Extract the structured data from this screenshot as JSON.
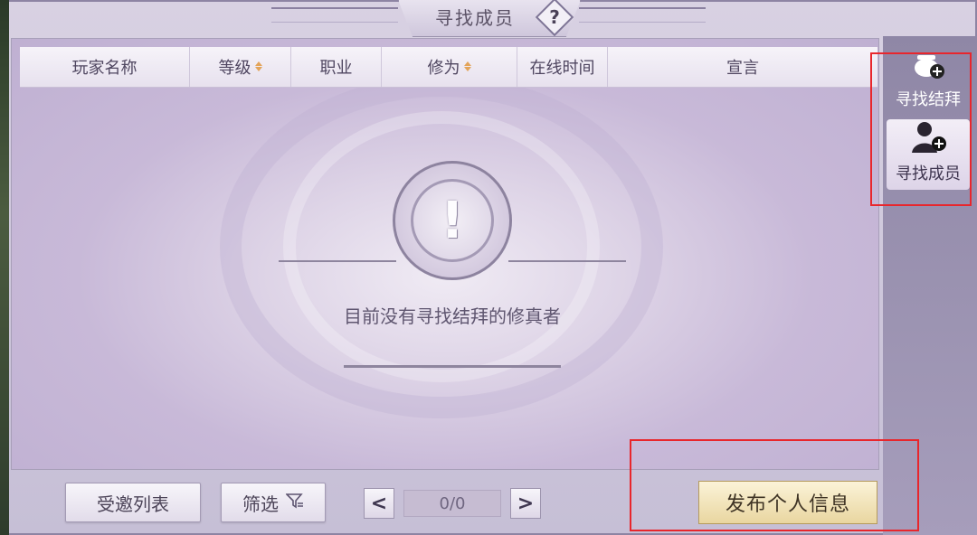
{
  "title": "寻找成员",
  "help_icon": "?",
  "table": {
    "columns": [
      {
        "label": "玩家名称",
        "sortable": false
      },
      {
        "label": "等级",
        "sortable": true
      },
      {
        "label": "职业",
        "sortable": false
      },
      {
        "label": "修为",
        "sortable": true
      },
      {
        "label": "在线时间",
        "sortable": false
      },
      {
        "label": "宣言",
        "sortable": false
      }
    ]
  },
  "empty_state": {
    "icon": "!",
    "message": "目前没有寻找结拜的修真者"
  },
  "buttons": {
    "invite_list": "受邀列表",
    "filter": "筛选",
    "publish": "发布个人信息"
  },
  "pager": {
    "value": "0/0",
    "prev": "<",
    "next": ">"
  },
  "side_tabs": [
    {
      "label": "寻找结拜",
      "icon": "cauldron-add-icon",
      "active": false
    },
    {
      "label": "寻找成员",
      "icon": "person-add-icon",
      "active": true
    }
  ],
  "colors": {
    "highlight": "#e8262c",
    "publish_gold": "#e9d6a0",
    "panel_purple": "#c8b9d8"
  }
}
